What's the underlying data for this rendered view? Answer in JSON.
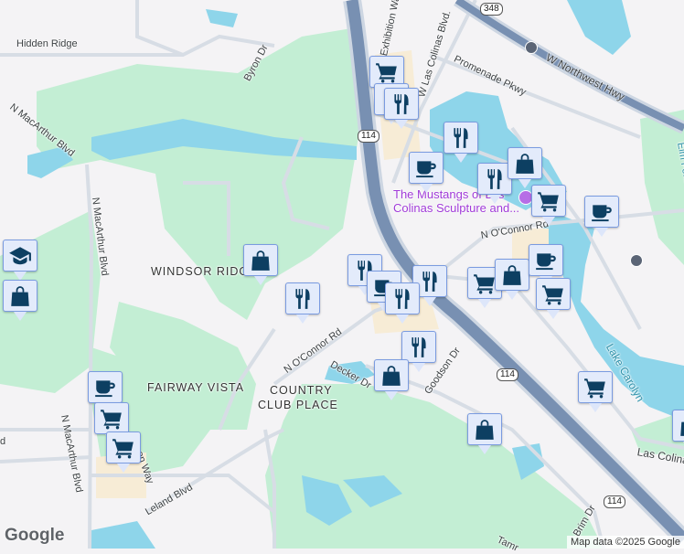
{
  "map": {
    "roads": {
      "hidden_ridge": "Hidden Ridge",
      "byron_dr": "Byron Dr",
      "n_macarthur_blvd_1": "N MacArthur Blvd",
      "n_macarthur_blvd_2": "N MacArthur Blvd",
      "n_macarthur_blvd_3": "N MacArthur Blvd",
      "exhibition_way": "Exhibition Way",
      "w_las_colinas_blvd": "W Las Colinas Blvd.",
      "promenade_pkwy": "Promenade Pkwy",
      "w_northwest_hwy": "W Northwest Hwy",
      "n_oconnor_rd_1": "N O'Connor Rd",
      "n_oconnor_rd_2": "N O'Connor Rd",
      "decker_dr": "Decker Dr",
      "goodson_dr": "Goodson Dr",
      "leland_blvd": "Leland Blvd",
      "brim_dr": "Brim Dr",
      "las_colinas": "Las Colinas",
      "elm_fork_trail": "Elm Fork Tr",
      "tamra": "Tamr",
      "on_way": "on Way",
      "left_d": "d"
    },
    "areas": {
      "windsor_ridge": "WINDSOR RIDGE",
      "fairway_vista": "FAIRWAY VISTA",
      "country_club_place_1": "COUNTRY",
      "country_club_place_2": "CLUB PLACE"
    },
    "water": {
      "lake_carolyn": "Lake Carolyn"
    },
    "poi": {
      "mustangs_1": "The Mustangs of Las",
      "mustangs_2": "Colinas Sculpture and..."
    },
    "shields": {
      "hwy348": "348",
      "hwy114_a": "114",
      "hwy114_b": "114",
      "hwy114_c": "114"
    },
    "markers": [
      "cart",
      "restaurant",
      "restaurant",
      "restaurant",
      "coffee",
      "restaurant",
      "shopping-bag",
      "cart",
      "coffee",
      "education",
      "shopping-bag",
      "shopping-bag",
      "restaurant",
      "restaurant",
      "coffee",
      "restaurant",
      "restaurant",
      "cart",
      "shopping-bag",
      "coffee",
      "cart",
      "restaurant",
      "shopping-bag",
      "cart",
      "shopping-bag",
      "shopping-bag",
      "coffee",
      "cart",
      "cart"
    ],
    "colors": {
      "park": "#c3eed4",
      "water": "#8ed5ea",
      "highway": "#7890b2",
      "marker_icon": "#0d3f62",
      "marker_bg": "#e3ebfb",
      "poi": "#a03ad8"
    }
  },
  "footer": {
    "logo": "Google",
    "attribution": "Map data ©2025 Google"
  }
}
